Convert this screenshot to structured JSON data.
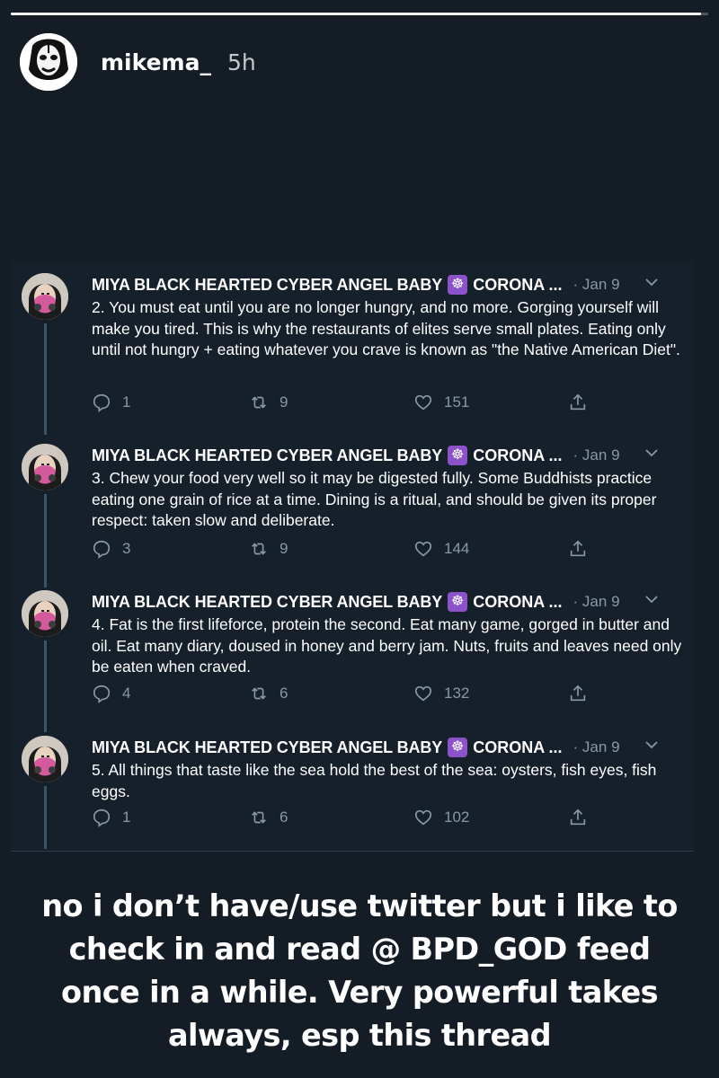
{
  "story": {
    "username": "mikema_",
    "time": "5h",
    "progress": 0.99,
    "caption": "no i don’t have/use twitter but i like to check in and read @ BPD_GOD feed once in a while. Very powerful takes always, esp this thread"
  },
  "tweets": [
    {
      "author": "MIYA BLACK HEARTED CYBER ANGEL BABY",
      "author_tail": "CORONA ...",
      "badge": "☸",
      "date": "· Jan 9",
      "text": "2. You must eat until you are no longer hungry, and no more. Gorging yourself will make you tired. This is why the restaurants of elites serve small plates. Eating only until not hungry + eating whatever you crave is known as \"the Native American Diet\".",
      "replies": "1",
      "retweets": "9",
      "likes": "151"
    },
    {
      "author": "MIYA BLACK HEARTED CYBER ANGEL BABY",
      "author_tail": "CORONA ...",
      "badge": "☸",
      "date": "· Jan 9",
      "text": "3. Chew your food very well so it may be digested fully. Some Buddhists practice eating one grain of rice at a time. Dining is a ritual, and should be given its proper respect: taken slow and deliberate.",
      "replies": "3",
      "retweets": "9",
      "likes": "144"
    },
    {
      "author": "MIYA BLACK HEARTED CYBER ANGEL BABY",
      "author_tail": "CORONA ...",
      "badge": "☸",
      "date": "· Jan 9",
      "text": "4. Fat is the first lifeforce, protein the second. Eat many game, gorged in butter and oil. Eat many diary, doused in honey and berry jam. Nuts, fruits and leaves need only be eaten when craved.",
      "replies": "4",
      "retweets": "6",
      "likes": "132"
    },
    {
      "author": "MIYA BLACK HEARTED CYBER ANGEL BABY",
      "author_tail": "CORONA ...",
      "badge": "☸",
      "date": "· Jan 9",
      "text": "5. All things that taste like the sea hold the best of the sea: oysters, fish eyes, fish eggs.",
      "replies": "1",
      "retweets": "6",
      "likes": "102"
    }
  ],
  "icons": {
    "reply": "reply-icon",
    "retweet": "retweet-icon",
    "like": "heart-icon",
    "share": "share-icon",
    "caret": "chevron-down-icon"
  },
  "colors": {
    "background": "#141c26",
    "tweet_background": "#15202b",
    "muted": "#8899a6",
    "badge": "#8c52c9"
  }
}
